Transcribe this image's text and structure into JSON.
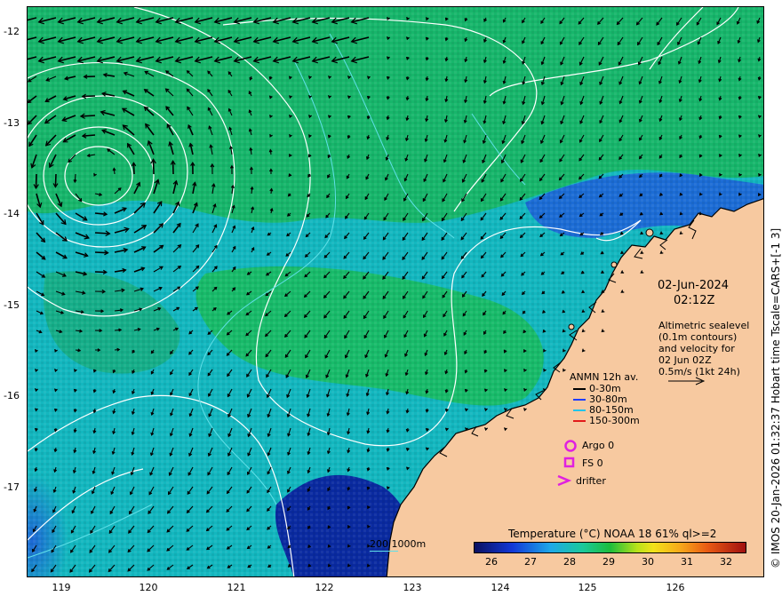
{
  "map": {
    "lat_labels": [
      "-12",
      "-13",
      "-14",
      "-15",
      "-16",
      "-17"
    ],
    "lon_labels": [
      "119",
      "120",
      "121",
      "122",
      "123",
      "124",
      "125",
      "126"
    ],
    "date": "02-Jun-2024",
    "time": "02:12Z",
    "altimetry_lines": [
      "Altimetric sealevel",
      "(0.1m contours)",
      "and velocity for",
      "02 Jun 02Z",
      "0.5m/s (1kt 24h)"
    ],
    "side_credit": "© IMOS 20-Jan-2026 01:32:37 Hobart time Tscale=CARS+[-1 3]",
    "depth_contours_label": "200  1000m",
    "colors": {
      "land": "#f7c9a0",
      "contour": "#ffffff",
      "isobath": "#5fe0e8",
      "ocean_warm": "#1cbd3c",
      "ocean_mid": "#12b5c9",
      "ocean_cool": "#1f5fd8",
      "ocean_cold": "#0a1f8a"
    }
  },
  "legend": {
    "anmn_title": "ANMN 12h av.",
    "depth_bins": [
      {
        "label": "0-30m",
        "color": "#000000"
      },
      {
        "label": "30-80m",
        "color": "#1f3cff"
      },
      {
        "label": "80-150m",
        "color": "#22c4e8"
      },
      {
        "label": "150-300m",
        "color": "#e21a1a"
      }
    ],
    "markers": [
      {
        "label": "Argo 0",
        "icon": "circle-icon",
        "color": "#e020e0"
      },
      {
        "label": "FS 0",
        "icon": "square-icon",
        "color": "#e020e0"
      },
      {
        "label": "drifter",
        "icon": "chevron-icon",
        "color": "#e020e0"
      }
    ]
  },
  "colorbar": {
    "title": "Temperature (°C) NOAA 18 61% ql>=2",
    "ticks": [
      "26",
      "27",
      "28",
      "29",
      "30",
      "31",
      "32"
    ]
  }
}
